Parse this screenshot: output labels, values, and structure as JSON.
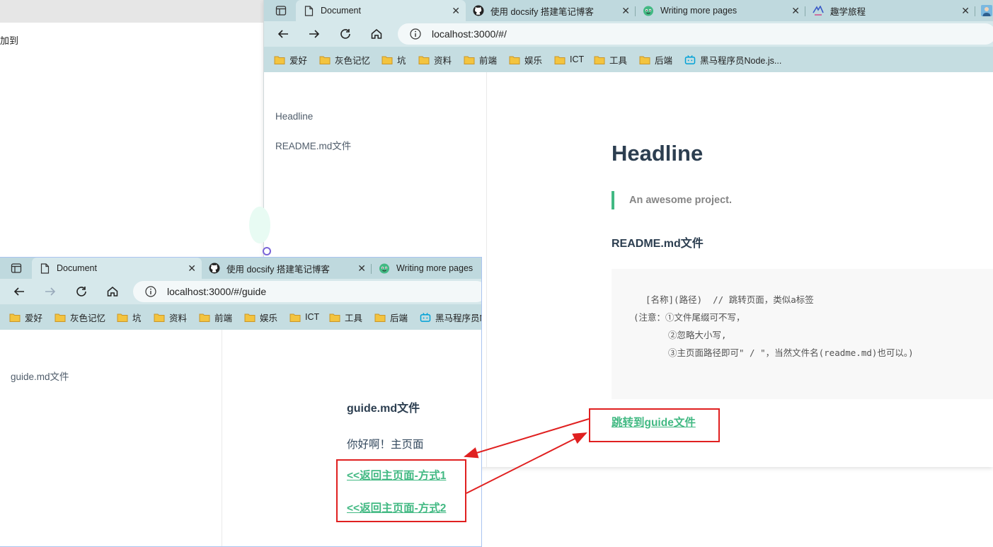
{
  "background": {
    "partial_text": "加到"
  },
  "main_window": {
    "tabs": [
      {
        "title": "Document",
        "icon": "document-icon",
        "active": true
      },
      {
        "title": "使用 docsify 搭建笔记博客",
        "icon": "github-icon"
      },
      {
        "title": "Writing more pages",
        "icon": "docsify-icon"
      },
      {
        "title": "趣学旅程",
        "icon": "site-icon"
      }
    ],
    "url": "localhost:3000/#/",
    "bookmarks": [
      "爱好",
      "灰色记忆",
      "坑",
      "资料",
      "前端",
      "娱乐",
      "ICT",
      "工具",
      "后端",
      "黑马程序员Node.js..."
    ],
    "sidebar": [
      "Headline",
      "README.md文件"
    ],
    "heading": "Headline",
    "blockquote": "An awesome project.",
    "subheading": "README.md文件",
    "code_lines": [
      "[名称](路径)  // 跳转页面，类似a标签",
      "(注意：①文件尾缀可不写，",
      "②忽略大小写,",
      "③主页面路径即可\" / \"，当然文件名(readme.md)也可以。)"
    ],
    "link": "跳转到guide文件"
  },
  "guide_window": {
    "tabs": [
      {
        "title": "Document",
        "icon": "document-icon",
        "active": true
      },
      {
        "title": "使用 docsify 搭建笔记博客",
        "icon": "github-icon"
      },
      {
        "title": "Writing more pages",
        "icon": "docsify-icon"
      }
    ],
    "url": "localhost:3000/#/guide",
    "bookmarks": [
      "爱好",
      "灰色记忆",
      "坑",
      "资料",
      "前端",
      "娱乐",
      "ICT",
      "工具",
      "后端",
      "黑马程序员N"
    ],
    "sidebar": [
      "guide.md文件"
    ],
    "subheading": "guide.md文件",
    "paragraph": "你好啊！主页面",
    "links": [
      "<<返回主页面-方式1",
      "<<返回主页面-方式2"
    ]
  },
  "colors": {
    "accent": "#42b983",
    "annotation": "#e02020",
    "tabbar": "#bfd9de",
    "toolbar": "#d6e8eb",
    "heading_text": "#2c3e50"
  }
}
